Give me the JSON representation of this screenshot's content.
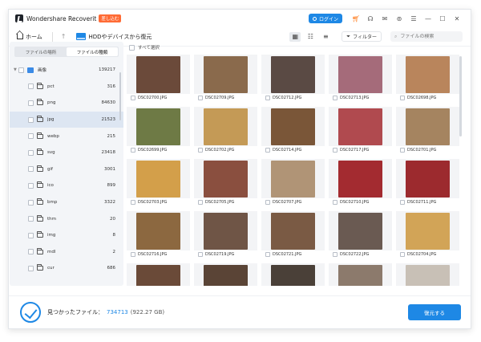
{
  "app": {
    "title": "Wondershare Recoverit",
    "plan_badge": "差し込む"
  },
  "titlebar": {
    "login_label": "ログイン",
    "icons": [
      "cart-icon",
      "headset-icon",
      "mail-icon",
      "update-icon",
      "menu-icon",
      "minimize-icon",
      "maximize-icon",
      "close-icon"
    ]
  },
  "toolbar": {
    "home_label": "ホーム",
    "breadcrumb": "HDDやデバイスから復元",
    "filter_label": "フィルター",
    "search_placeholder": "ファイルの検索"
  },
  "sidebar": {
    "tab_location": "ファイルの場所",
    "tab_type": "ファイルの種類",
    "root": {
      "label": "画像",
      "count": "139217"
    },
    "items": [
      {
        "label": "pct",
        "count": "316"
      },
      {
        "label": "png",
        "count": "84630"
      },
      {
        "label": "jpg",
        "count": "21523"
      },
      {
        "label": "webp",
        "count": "215"
      },
      {
        "label": "svg",
        "count": "23418"
      },
      {
        "label": "gif",
        "count": "3001"
      },
      {
        "label": "ico",
        "count": "899"
      },
      {
        "label": "bmp",
        "count": "3322"
      },
      {
        "label": "thm",
        "count": "20"
      },
      {
        "label": "img",
        "count": "8"
      },
      {
        "label": "mdl",
        "count": "2"
      },
      {
        "label": "cur",
        "count": "686"
      }
    ]
  },
  "main": {
    "select_all_label": "すべて選択",
    "files": [
      {
        "name": "DSC02700.JPG",
        "color": "#6b4a3a"
      },
      {
        "name": "DSC02709.JPG",
        "color": "#8a6a4c"
      },
      {
        "name": "DSC02712.JPG",
        "color": "#5a4a44"
      },
      {
        "name": "DSC02713.JPG",
        "color": "#a56b7a"
      },
      {
        "name": "DSC02698.JPG",
        "color": "#b9855c"
      },
      {
        "name": "DSC02699.JPG",
        "color": "#6e7a45"
      },
      {
        "name": "DSC02702.JPG",
        "color": "#c49a56"
      },
      {
        "name": "DSC02714.JPG",
        "color": "#7a5638"
      },
      {
        "name": "DSC02717.JPG",
        "color": "#b04a4f"
      },
      {
        "name": "DSC02701.JPG",
        "color": "#a58460"
      },
      {
        "name": "DSC02703.JPG",
        "color": "#d39f4a"
      },
      {
        "name": "DSC02705.JPG",
        "color": "#8a4f3f"
      },
      {
        "name": "DSC02707.JPG",
        "color": "#b09476"
      },
      {
        "name": "DSC02710.JPG",
        "color": "#a32b30"
      },
      {
        "name": "DSC02711.JPG",
        "color": "#9c2a2e"
      },
      {
        "name": "DSC02716.JPG",
        "color": "#8c6840"
      },
      {
        "name": "DSC02719.JPG",
        "color": "#6f5546"
      },
      {
        "name": "DSC02721.JPG",
        "color": "#7a5a44"
      },
      {
        "name": "DSC02722.JPG",
        "color": "#6a5a52"
      },
      {
        "name": "DSC02704.JPG",
        "color": "#d2a457"
      },
      {
        "name": "",
        "color": "#6a4a38"
      },
      {
        "name": "",
        "color": "#5a4436"
      },
      {
        "name": "",
        "color": "#4a4038"
      },
      {
        "name": "",
        "color": "#8c7a6c"
      },
      {
        "name": "",
        "color": "#c8c0b6"
      }
    ]
  },
  "footer": {
    "found_label": "見つかったファイル：",
    "found_count": "734713",
    "found_size": "(922.27 GB)",
    "recover_label": "復元する"
  },
  "colors": {
    "accent": "#1e88e5",
    "badge": "#ff6b35"
  }
}
